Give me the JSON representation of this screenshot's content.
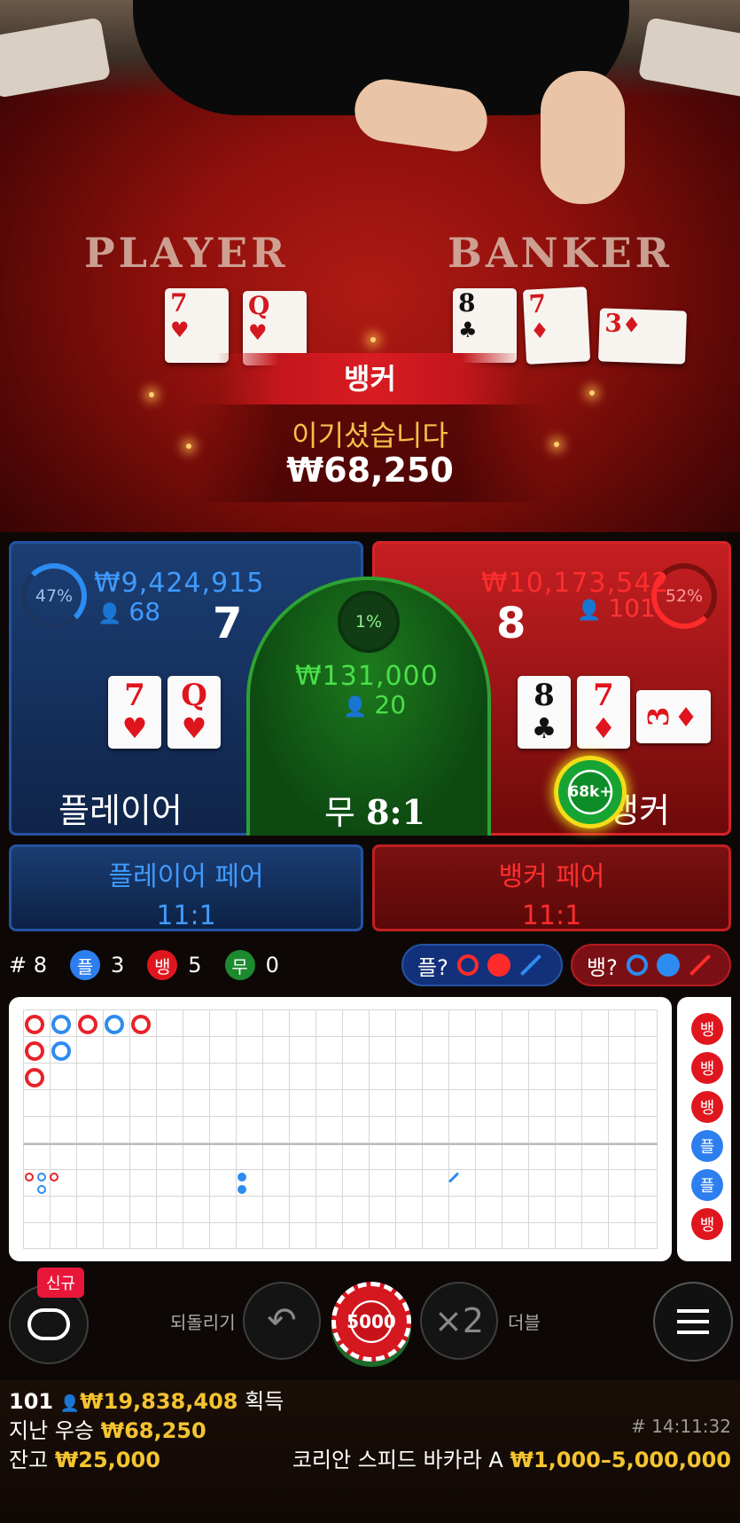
{
  "video": {
    "felt_player": "PLAYER",
    "felt_banker": "BANKER",
    "player_cards": [
      {
        "rank": "7",
        "suit": "♥"
      },
      {
        "rank": "Q",
        "suit": "♥"
      }
    ],
    "banker_cards": [
      {
        "rank": "8",
        "suit": "♣"
      },
      {
        "rank": "7",
        "suit": "♦"
      },
      {
        "rank": "3",
        "suit": "♦"
      }
    ],
    "winner_label": "뱅커",
    "win_message": "이기셨습니다",
    "win_amount": "₩68,250"
  },
  "board": {
    "player": {
      "percent": "47%",
      "amount": "₩9,424,915",
      "count": "68",
      "score": "7",
      "label": "플레이어",
      "cards": [
        {
          "rank": "7",
          "suit": "♥"
        },
        {
          "rank": "Q",
          "suit": "♥"
        }
      ]
    },
    "tie": {
      "percent": "1%",
      "amount": "₩131,000",
      "count": "20",
      "label": "무",
      "odds": "8:1"
    },
    "banker": {
      "percent": "52%",
      "amount": "₩10,173,542",
      "count": "101",
      "score": "8",
      "label": "뱅커",
      "cards": [
        {
          "rank": "8",
          "suit": "♣"
        },
        {
          "rank": "7",
          "suit": "♦"
        },
        {
          "rank": "3",
          "suit": "♦"
        }
      ],
      "chip": "68k+"
    },
    "player_pair": {
      "label": "플레이어 페어",
      "odds": "11:1"
    },
    "banker_pair": {
      "label": "뱅커 페어",
      "odds": "11:1"
    }
  },
  "stats": {
    "round": "# 8",
    "player_icon": "플",
    "player_count": "3",
    "banker_icon": "뱅",
    "banker_count": "5",
    "tie_icon": "무",
    "tie_count": "0",
    "ask_player": "플?",
    "ask_banker": "뱅?"
  },
  "side_road": [
    "뱅",
    "뱅",
    "뱅",
    "플",
    "플",
    "뱅"
  ],
  "controls": {
    "new_badge": "신규",
    "undo_label": "되돌리기",
    "undo_icon": "↶",
    "chip_value": "5000",
    "double_icon": "×2",
    "double_label": "더블"
  },
  "footer": {
    "players": "101",
    "total_won": "₩19,838,408",
    "won_label": "획득",
    "last_win_label": "지난 우승",
    "last_win": "₩68,250",
    "balance_label": "잔고",
    "balance": "₩25,000",
    "time": "# 14:11:32",
    "table_name": "코리안 스피드 바카라 A",
    "limits": "₩1,000–5,000,000"
  },
  "colors": {
    "player": "#2d8cf0",
    "banker": "#e0161e",
    "tie": "#1c8a2d",
    "gold": "#f4c430"
  }
}
